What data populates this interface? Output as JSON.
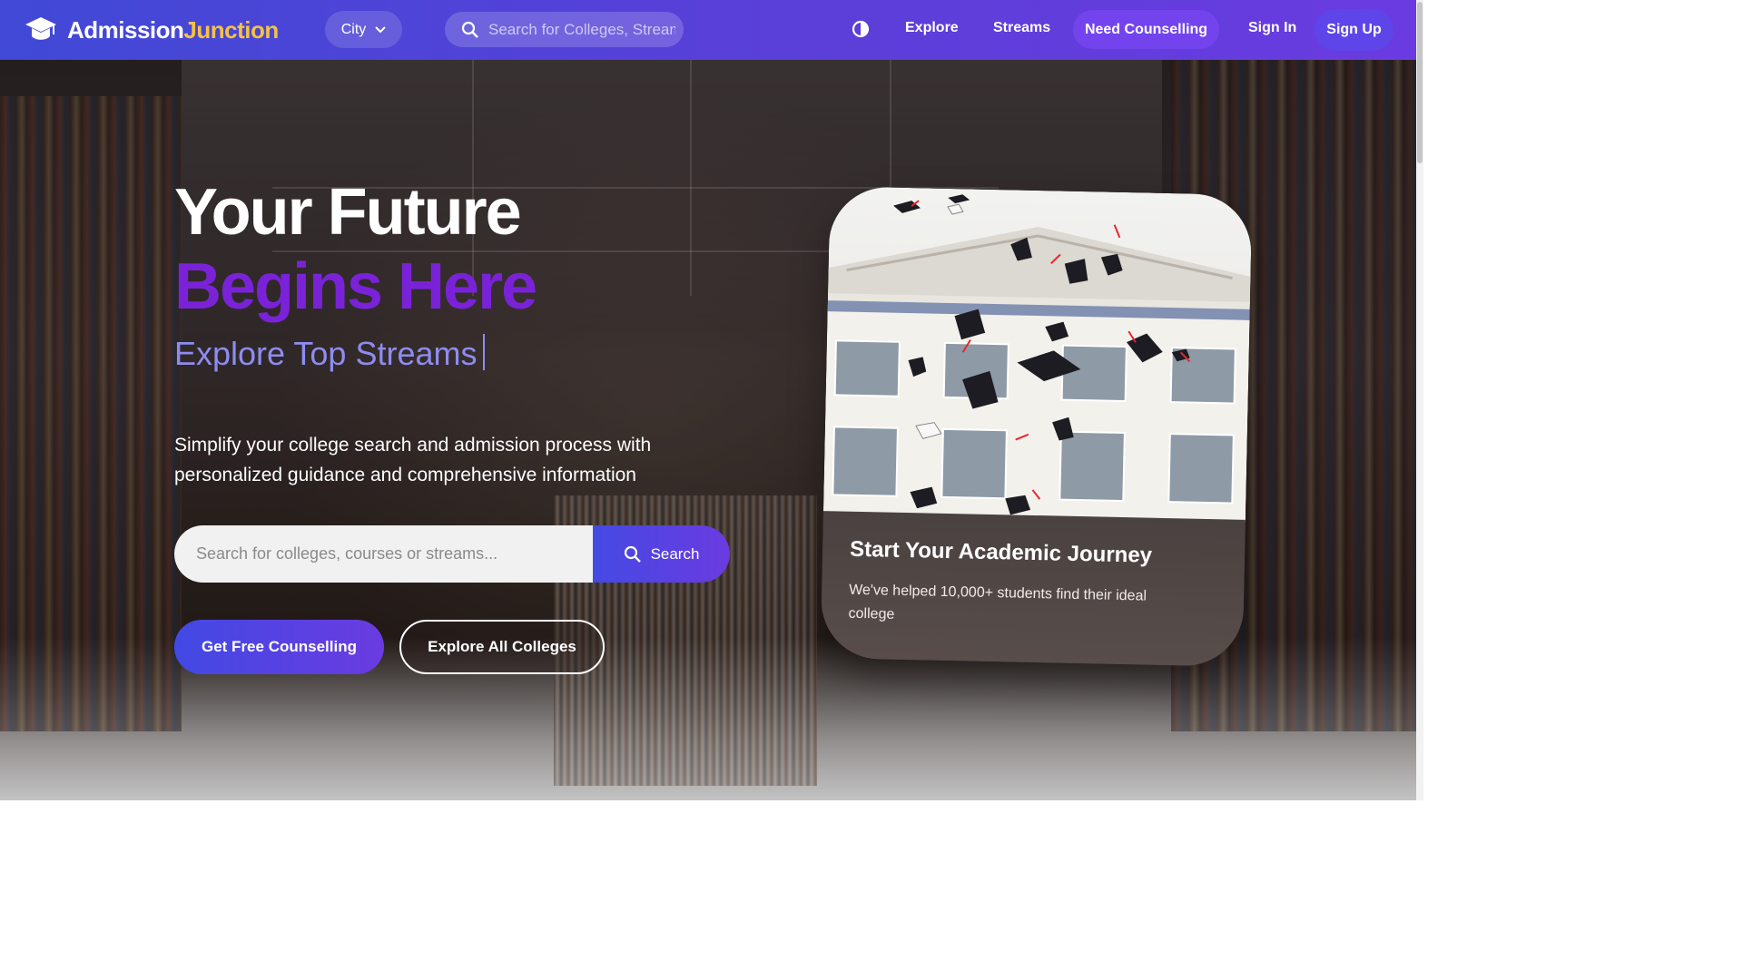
{
  "nav": {
    "logo_main": "Admission",
    "logo_accent": "Junction",
    "city_label": "City",
    "search_placeholder": "Search for Colleges, Streams",
    "explore": "Explore",
    "streams": "Streams",
    "need_counselling": "Need Counselling",
    "sign_in": "Sign In",
    "sign_up": "Sign Up"
  },
  "hero": {
    "title_line1": "Your Future",
    "title_line2": "Begins Here",
    "typing_text": "Explore Top Streams",
    "lead": "Simplify your college search and admission process with personalized guidance and comprehensive information",
    "search_placeholder": "Search for colleges, courses or streams...",
    "search_button": "Search",
    "cta_primary": "Get Free Counselling",
    "cta_secondary": "Explore All Colleges"
  },
  "card": {
    "title": "Start Your Academic Journey",
    "subtitle": "We've helped 10,000+ students find their ideal college"
  },
  "colors": {
    "accent_gold": "#f5c242",
    "title_purple": "#7a22d8",
    "typing_lavender": "#8e8cf2",
    "brand_indigo": "#4249e4"
  }
}
